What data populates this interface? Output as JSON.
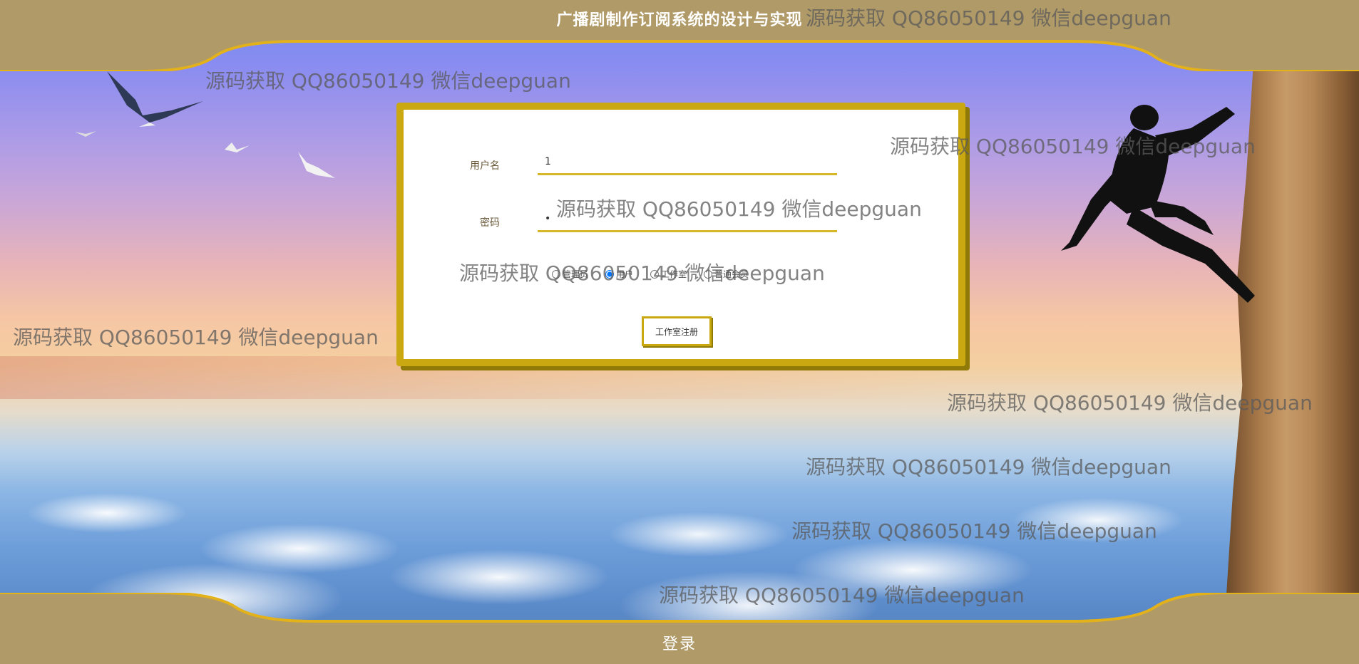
{
  "header": {
    "title": "广播剧制作订阅系统的设计与实现"
  },
  "footer": {
    "title": "登录"
  },
  "login_form": {
    "username_label": "用户名",
    "username_value": "1",
    "password_label": "密码",
    "password_value": "1",
    "roles": [
      {
        "label": "管理员",
        "selected": false
      },
      {
        "label": "用户",
        "selected": true
      },
      {
        "label": "工作室",
        "selected": false
      },
      {
        "label": "普通会员",
        "selected": false
      }
    ],
    "register_label": "工作室注册"
  },
  "watermark": {
    "text": "源码获取 QQ86050149 微信deepguan"
  },
  "colors": {
    "frame": "#b09a68",
    "frame_border": "#e3b21a",
    "card_border": "#c9a812"
  }
}
